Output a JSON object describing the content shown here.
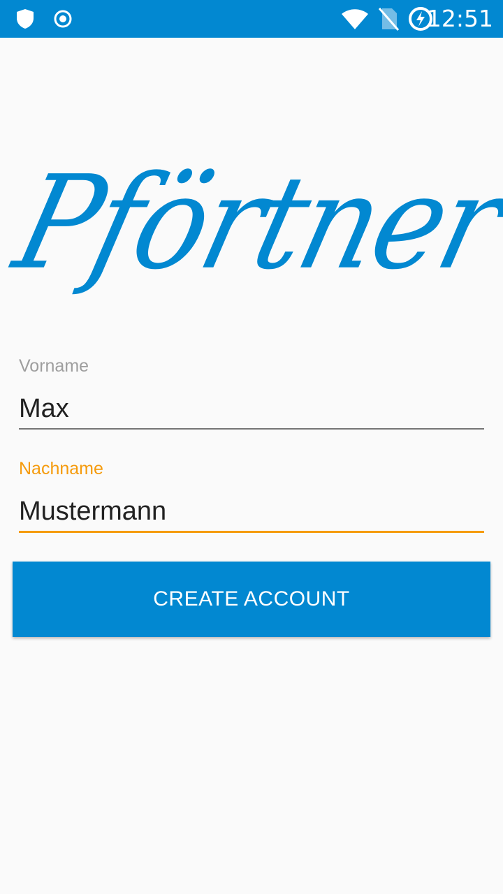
{
  "status_bar": {
    "time": "12:51",
    "background_color": "#0288d1",
    "icons_left": [
      "shield-icon",
      "record-icon"
    ],
    "icons_right": [
      "wifi-icon",
      "no-sim-icon",
      "battery-charging-icon"
    ]
  },
  "logo": {
    "text": "Pförtner",
    "color": "#0288d1"
  },
  "form": {
    "first_name": {
      "label": "Vorname",
      "value": "Max"
    },
    "last_name": {
      "label": "Nachname",
      "value": "Mustermann",
      "focused": true,
      "accent_color": "#f59b0d"
    }
  },
  "actions": {
    "create_account_label": "CREATE ACCOUNT"
  }
}
